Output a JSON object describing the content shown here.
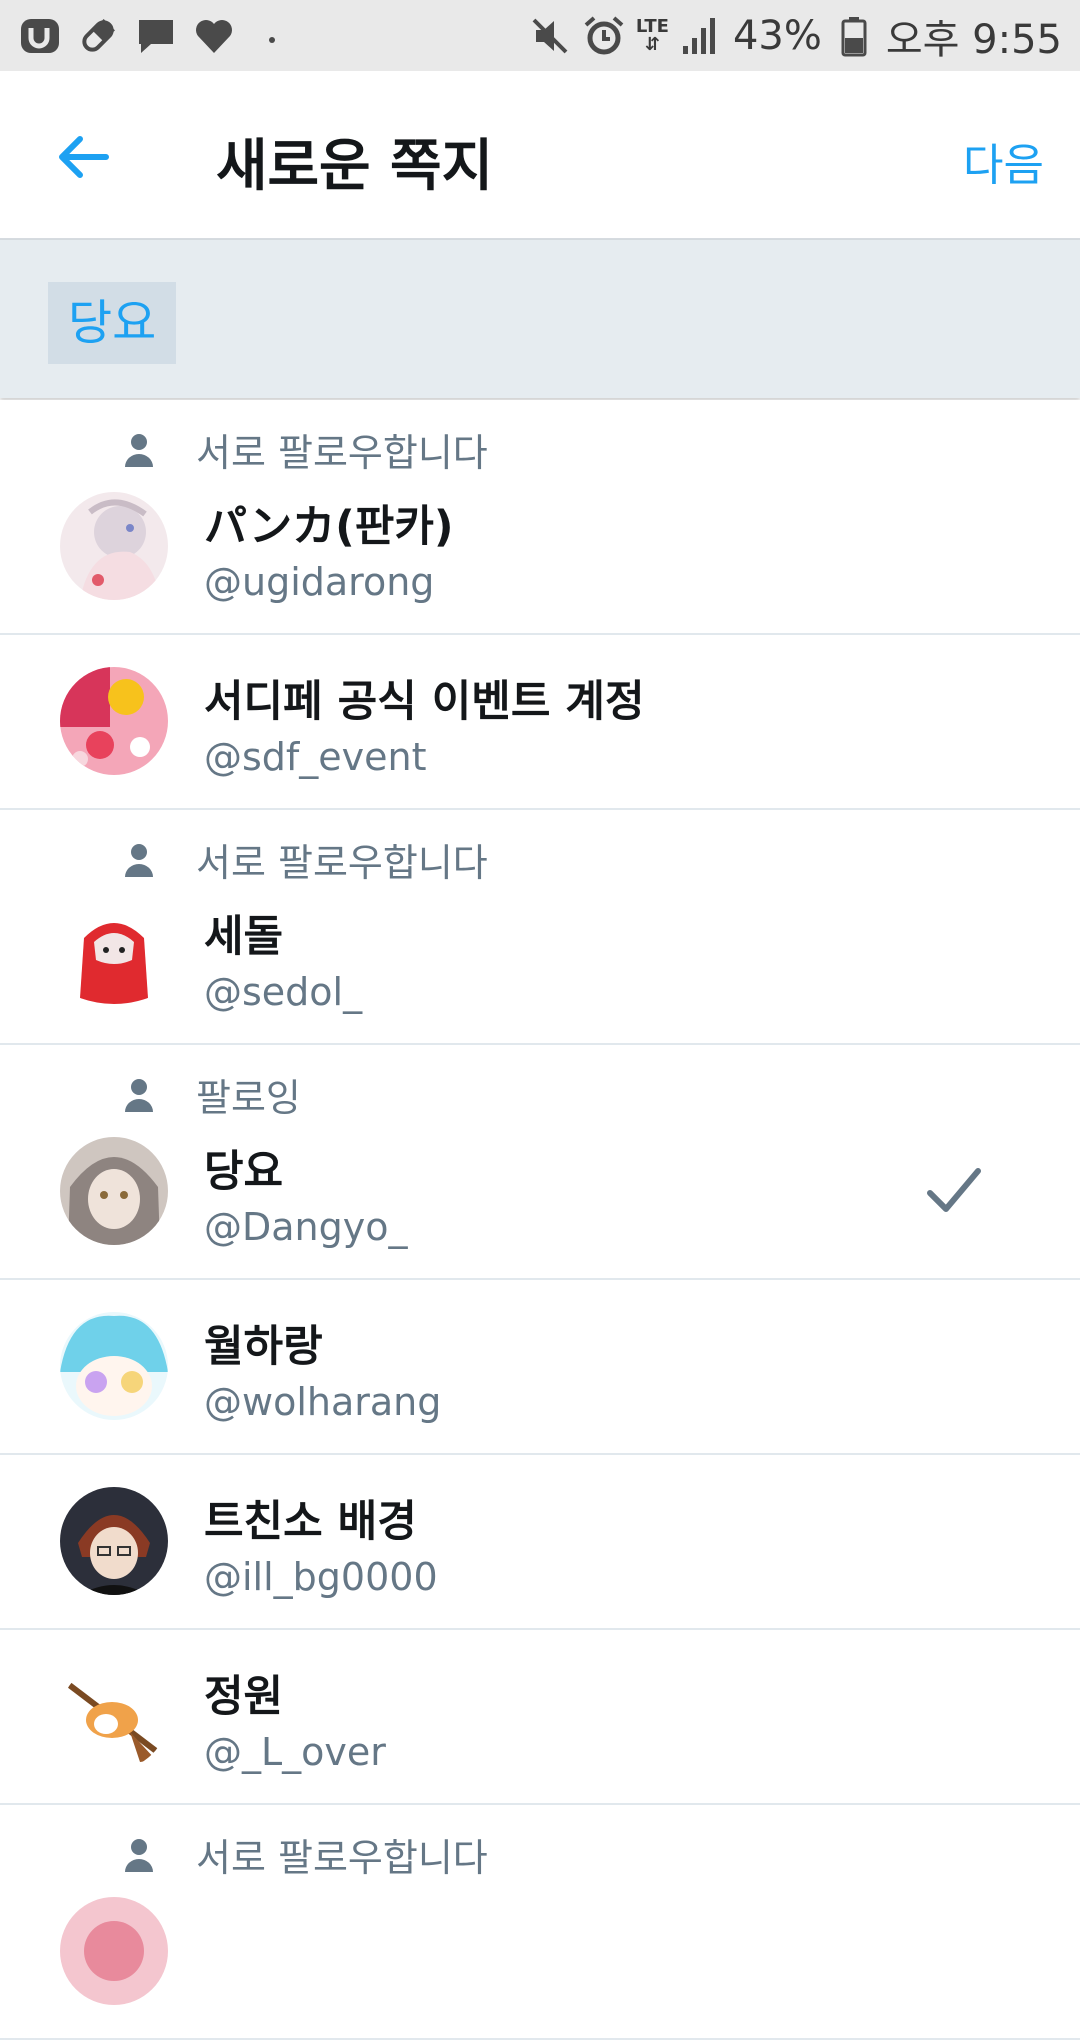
{
  "status_bar": {
    "battery": "43%",
    "time": "오후 9:55",
    "network": "LTE",
    "left_icons": [
      "app-icon",
      "pill-icon",
      "chat-icon",
      "heart-icon",
      "dot-icon"
    ],
    "right_icons": [
      "mute-icon",
      "alarm-icon",
      "lte-icon",
      "signal-icon",
      "battery-icon"
    ]
  },
  "header": {
    "title": "새로운 쪽지",
    "next_label": "다음",
    "back_icon": "back-arrow-icon"
  },
  "recipient": {
    "chip_label": "당요"
  },
  "colors": {
    "accent": "#1da1f2",
    "secondary_text": "#657786",
    "divider": "#e1e8ed",
    "recipient_bg": "#e6ecf0"
  },
  "users": [
    {
      "context": "서로 팔로우합니다",
      "name": "パンカ(판카)",
      "handle": "@ugidarong",
      "selected": false
    },
    {
      "context": "",
      "name": "서디페 공식 이벤트 계정",
      "handle": "@sdf_event",
      "selected": false
    },
    {
      "context": "서로 팔로우합니다",
      "name": "세돌",
      "handle": "@sedol_",
      "selected": false
    },
    {
      "context": "팔로잉",
      "name": "당요",
      "handle": "@Dangyo_",
      "selected": true
    },
    {
      "context": "",
      "name": "월하랑",
      "handle": "@wolharang",
      "selected": false
    },
    {
      "context": "",
      "name": "트친소 배경",
      "handle": "@ill_bg0000",
      "selected": false
    },
    {
      "context": "",
      "name": "정원",
      "handle": "@_L_over",
      "selected": false
    },
    {
      "context": "서로 팔로우합니다",
      "name": "",
      "handle": "",
      "selected": false
    }
  ]
}
